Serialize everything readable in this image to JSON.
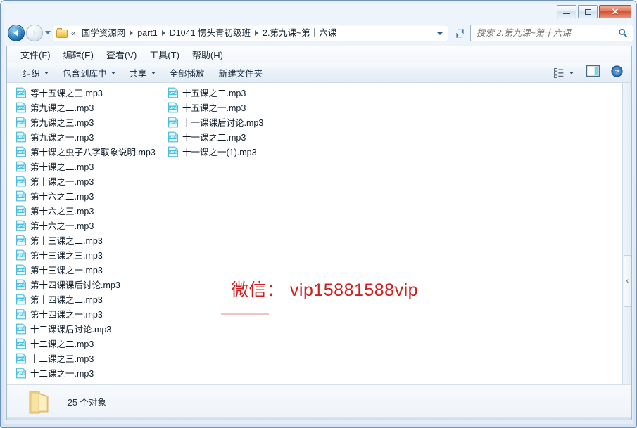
{
  "window": {
    "caption_buttons": {
      "minimize_label": "–",
      "restore_label": "□",
      "close_label": "✕"
    }
  },
  "navigation": {
    "back_tooltip": "后退",
    "forward_tooltip": "前进",
    "history_tooltip": "最近浏览的位置",
    "refresh_tooltip": "刷新"
  },
  "address_bar": {
    "leading_chevrons": "«",
    "crumbs": [
      "国学资源网",
      "part1",
      "D1041 愣头青初级班",
      "2.第九课~第十六课"
    ],
    "dropdown_icon": "chevron-down-icon",
    "folder_icon": "folder-icon"
  },
  "search": {
    "placeholder": "搜索 2.第九课~第十六课",
    "value": "",
    "icon": "search-icon"
  },
  "menubar": {
    "items": [
      "文件(F)",
      "编辑(E)",
      "查看(V)",
      "工具(T)",
      "帮助(H)"
    ]
  },
  "command_bar": {
    "items": [
      {
        "label": "组织",
        "has_caret": true
      },
      {
        "label": "包含到库中",
        "has_caret": true
      },
      {
        "label": "共享",
        "has_caret": true
      },
      {
        "label": "全部播放",
        "has_caret": false
      },
      {
        "label": "新建文件夹",
        "has_caret": false
      }
    ],
    "right_icons": [
      "view-layout-icon",
      "chevron-down-icon",
      "preview-pane-icon",
      "help-icon"
    ]
  },
  "file_list": {
    "column_a": [
      "等十五课之三.mp3",
      "第九课之二.mp3",
      "第九课之三.mp3",
      "第九课之一.mp3",
      "第十课之虫子八字取象说明.mp3",
      "第十课之二.mp3",
      "第十课之一.mp3",
      "第十六之二.mp3",
      "第十六之三.mp3",
      "第十六之一.mp3",
      "第十三课之二.mp3",
      "第十三课之三.mp3",
      "第十三课之一.mp3",
      "第十四课课后讨论.mp3",
      "第十四课之二.mp3",
      "第十四课之一.mp3",
      "十二课课后讨论.mp3",
      "十二课之二.mp3",
      "十二课之三.mp3",
      "十二课之一.mp3"
    ],
    "column_b": [
      "十五课之二.mp3",
      "十五课之一.mp3",
      "十一课课后讨论.mp3",
      "十一课之二.mp3",
      "十一课之一(1).mp3"
    ],
    "item_icon": "mp3-file-icon"
  },
  "watermark": {
    "text": "微信： vip15881588vip",
    "color": "#d01f1f"
  },
  "preview_pane": {
    "collapse_chevron": "‹",
    "icon": "chevron-left-icon"
  },
  "status_bar": {
    "count_text": "25 个对象",
    "folder_icon": "folder-icon"
  }
}
